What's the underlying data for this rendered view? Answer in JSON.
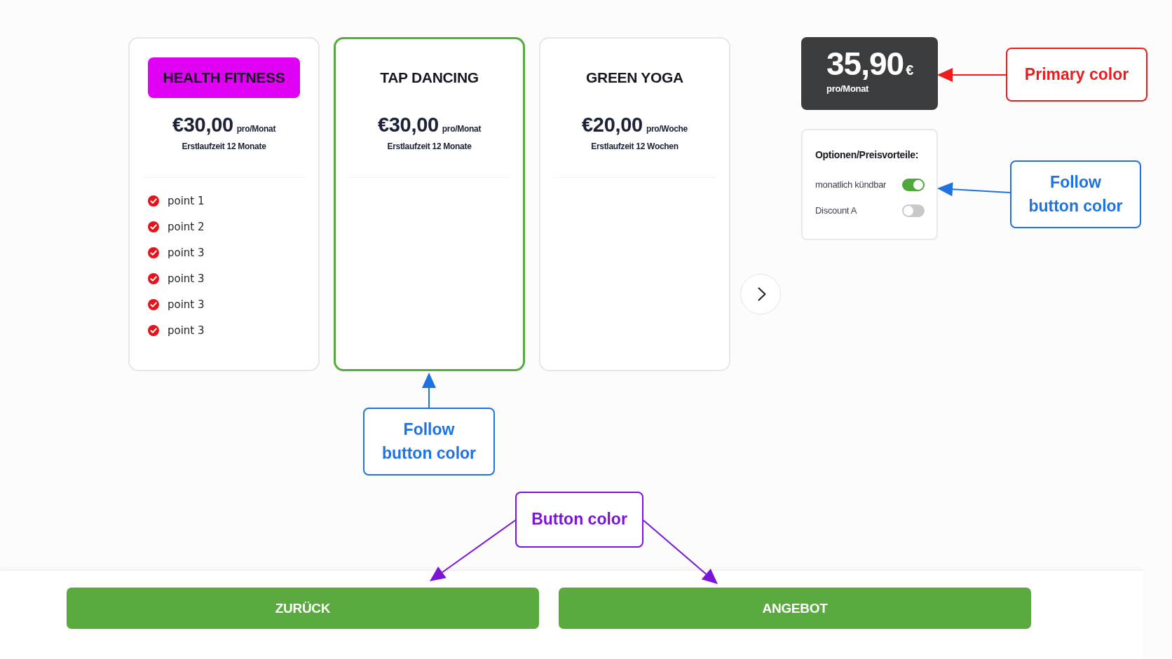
{
  "plans": [
    {
      "title": "HEALTH FITNESS",
      "color": "#e000f4",
      "price": "€30,00",
      "period": "pro/Monat",
      "term": "Erstlaufzeit 12 Monate",
      "selected": false,
      "features": [
        "point 1",
        "point 2",
        "point 3",
        "point 3",
        "point 3",
        "point 3"
      ]
    },
    {
      "title": "TAP DANCING",
      "price": "€30,00",
      "period": "pro/Monat",
      "term": "Erstlaufzeit 12 Monate",
      "selected": true,
      "annotation": {
        "text": "Follow button color",
        "color": "#1f73e0"
      }
    },
    {
      "title": "GREEN YOGA",
      "price": "€20,00",
      "period": "pro/Woche",
      "term": "Erstlaufzeit 12 Wochen",
      "selected": false
    }
  ],
  "summary": {
    "price": "35,90",
    "currency": "€",
    "period": "pro/Monat",
    "annotation": {
      "text": "Primary color",
      "color": "#ee1c1c"
    }
  },
  "options": {
    "title": "Optionen/Preisvorteile:",
    "items": [
      {
        "label": "monatlich kündbar",
        "on": true
      },
      {
        "label": "Discount A",
        "on": false
      }
    ],
    "annotation": {
      "text": "Follow button color",
      "color": "#1f73e0"
    }
  },
  "footer": {
    "buttons": [
      "ZURÜCK",
      "ANGEBOT"
    ],
    "annotation": {
      "text": "Button color",
      "color": "#7a14d8"
    }
  }
}
